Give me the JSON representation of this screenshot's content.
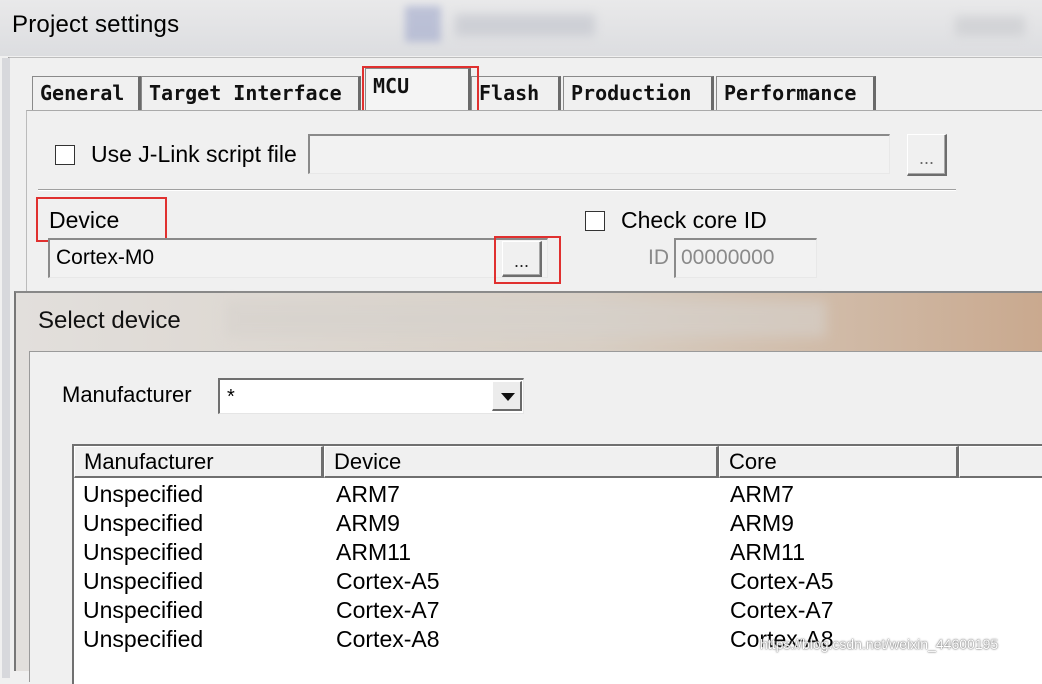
{
  "window": {
    "title": "Project settings"
  },
  "tabs": [
    {
      "label": "General"
    },
    {
      "label": "Target Interface"
    },
    {
      "label": "MCU"
    },
    {
      "label": "Flash"
    },
    {
      "label": "Production"
    },
    {
      "label": "Performance"
    }
  ],
  "active_tab": "MCU",
  "mcu": {
    "script_checkbox_label": "Use J-Link script file",
    "script_browse_label": "...",
    "device_label": "Device",
    "device_value": "Cortex-M0",
    "device_browse_label": "...",
    "check_core_label": "Check core ID",
    "id_label": "ID",
    "id_value": "00000000"
  },
  "select_device": {
    "title": "Select device",
    "manufacturer_label": "Manufacturer",
    "manufacturer_value": "*",
    "columns": [
      "Manufacturer",
      "Device",
      "Core"
    ],
    "rows": [
      [
        "Unspecified",
        "ARM7",
        "ARM7"
      ],
      [
        "Unspecified",
        "ARM9",
        "ARM9"
      ],
      [
        "Unspecified",
        "ARM11",
        "ARM11"
      ],
      [
        "Unspecified",
        "Cortex-A5",
        "Cortex-A5"
      ],
      [
        "Unspecified",
        "Cortex-A7",
        "Cortex-A7"
      ],
      [
        "Unspecified",
        "Cortex-A8",
        "Cortex-A8"
      ]
    ]
  },
  "watermark": "https://blog.csdn.net/weixin_44600195",
  "colors": {
    "highlight_box": "#e0302f"
  }
}
